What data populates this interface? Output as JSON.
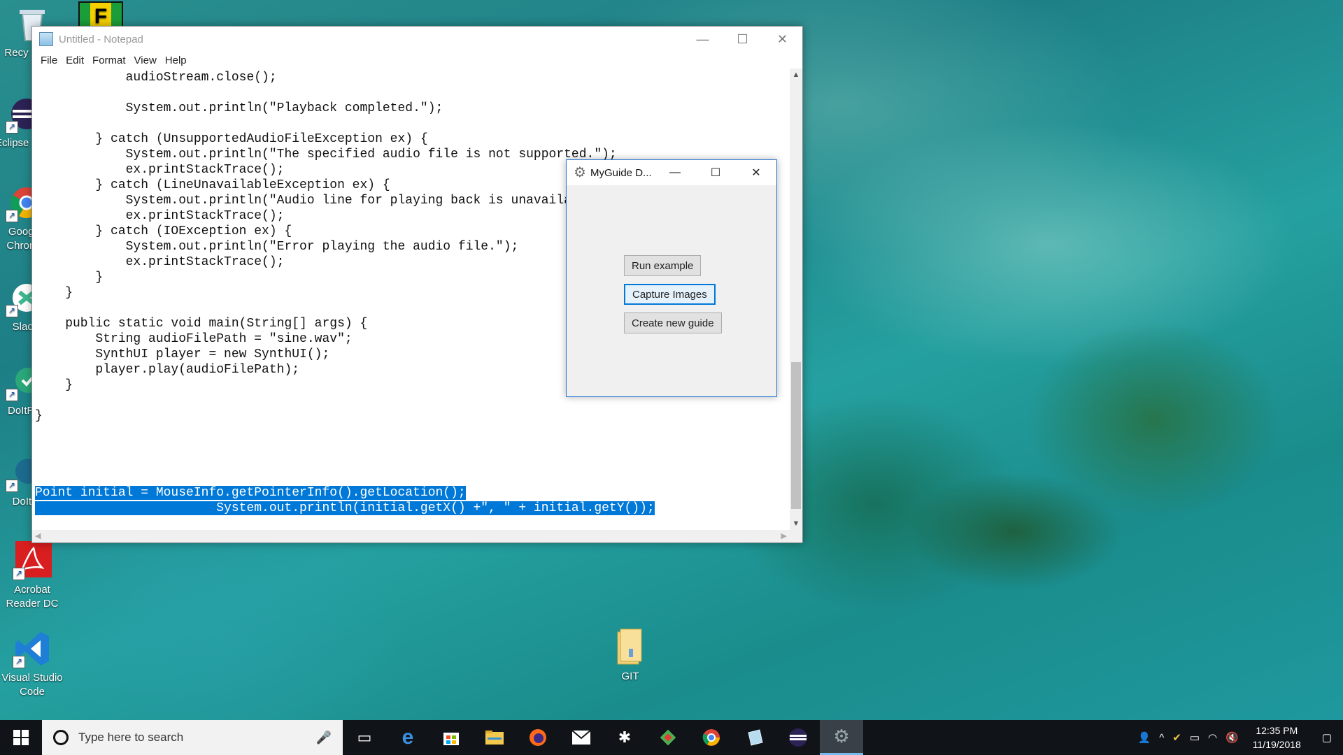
{
  "desktop": {
    "icons": [
      {
        "label": "Recycle Bin",
        "icon": "recycle-bin-icon"
      },
      {
        "label": "Eclipse 2018",
        "icon": "eclipse-icon"
      },
      {
        "label": "Google Chrome",
        "icon": "chrome-icon"
      },
      {
        "label": "Slack",
        "icon": "slack-icon"
      },
      {
        "label": "DoItFor",
        "icon": "doitfor-icon"
      },
      {
        "label": "DoItF",
        "icon": "doitf-icon"
      },
      {
        "label": "Acrobat Reader DC",
        "icon": "acrobat-reader-icon"
      },
      {
        "label": "Visual Studio Code",
        "icon": "vscode-icon"
      },
      {
        "label": "GIT",
        "icon": "folder-icon"
      }
    ]
  },
  "notepad": {
    "title": "Untitled - Notepad",
    "menu": [
      "File",
      "Edit",
      "Format",
      "View",
      "Help"
    ],
    "code": "            audioStream.close();\n\n            System.out.println(\"Playback completed.\");\n\n        } catch (UnsupportedAudioFileException ex) {\n            System.out.println(\"The specified audio file is not supported.\");\n            ex.printStackTrace();\n        } catch (LineUnavailableException ex) {\n            System.out.println(\"Audio line for playing back is unavailable.\");\n            ex.printStackTrace();\n        } catch (IOException ex) {\n            System.out.println(\"Error playing the audio file.\");\n            ex.printStackTrace();\n        }\n    }\n\n    public static void main(String[] args) {\n        String audioFilePath = \"sine.wav\";\n        SynthUI player = new SynthUI();\n        player.play(audioFilePath);\n    }\n\n}\n\n\n\n\n",
    "selected_line1": "Point initial = MouseInfo.getPointerInfo().getLocation();",
    "selected_line2": "                        System.out.println(initial.getX() +\", \" + initial.getY());"
  },
  "dialog": {
    "title": "MyGuide D...",
    "buttons": {
      "run": "Run example",
      "capture": "Capture Images",
      "create": "Create new guide"
    }
  },
  "taskbar": {
    "search_placeholder": "Type here to search",
    "apps": [
      "task-view-icon",
      "edge-icon",
      "store-icon",
      "file-explorer-icon",
      "firefox-icon",
      "mail-icon",
      "slack-icon",
      "git-icon",
      "chrome-icon",
      "notepad-icon",
      "eclipse-icon",
      "myguide-icon"
    ],
    "time": "12:35 PM",
    "date": "11/19/2018"
  },
  "colors": {
    "selection": "#0078d7",
    "taskbar": "#101418",
    "dialog_border": "#2b78d0"
  }
}
